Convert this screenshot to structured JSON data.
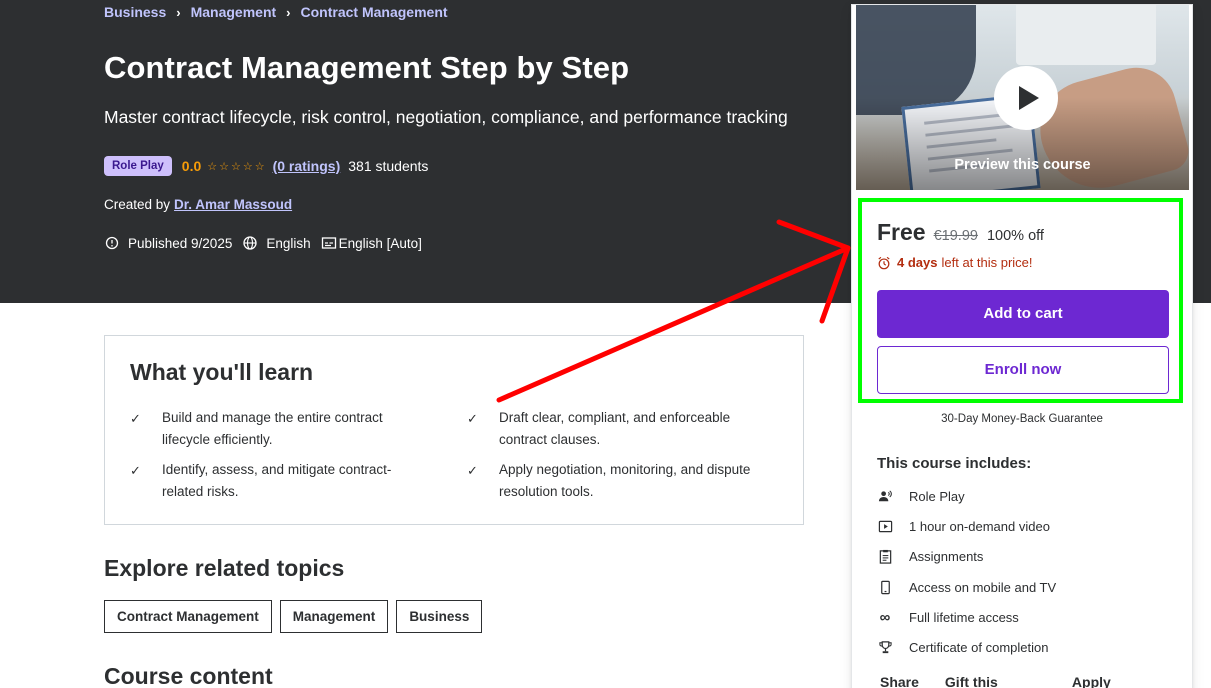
{
  "breadcrumb": [
    "Business",
    "Management",
    "Contract Management"
  ],
  "course": {
    "title": "Contract Management Step by Step",
    "subtitle": "Master contract lifecycle, risk control, negotiation, compliance, and performance tracking",
    "badge": "Role Play",
    "rating": "0.0",
    "ratings_count": "(0 ratings)",
    "students": "381 students",
    "created_by_label": "Created by",
    "author": "Dr. Amar Massoud",
    "published": "Published 9/2025",
    "language": "English",
    "captions": "English [Auto]"
  },
  "learn": {
    "title": "What you'll learn",
    "items": [
      "Build and manage the entire contract lifecycle efficiently.",
      "Draft clear, compliant, and enforceable contract clauses.",
      "Identify, assess, and mitigate contract-related risks.",
      "Apply negotiation, monitoring, and dispute resolution tools."
    ]
  },
  "related": {
    "title": "Explore related topics",
    "topics": [
      "Contract Management",
      "Management",
      "Business"
    ]
  },
  "course_content_title": "Course content",
  "sidebar": {
    "preview_label": "Preview this course",
    "price": "Free",
    "original_price": "€19.99",
    "discount": "100% off",
    "timer_days": "4 days",
    "timer_rest": "left at this price!",
    "add_to_cart": "Add to cart",
    "enroll_now": "Enroll now",
    "guarantee": "30-Day Money-Back Guarantee",
    "includes_title": "This course includes:",
    "includes": [
      {
        "icon": "role-play-icon",
        "label": "Role Play"
      },
      {
        "icon": "video-icon",
        "label": "1 hour on-demand video"
      },
      {
        "icon": "assignment-icon",
        "label": "Assignments"
      },
      {
        "icon": "mobile-icon",
        "label": "Access on mobile and TV"
      },
      {
        "icon": "infinity-icon",
        "label": "Full lifetime access"
      },
      {
        "icon": "trophy-icon",
        "label": "Certificate of completion"
      }
    ],
    "footer_links": [
      "Share",
      "Gift this course",
      "Apply Coupon"
    ]
  },
  "colors": {
    "hero_bg": "#2d2f31",
    "accent_purple": "#6d28d2",
    "link_lavender": "#c0c4fc",
    "star_orange": "#f69c08",
    "timer_red": "#b32d0f",
    "highlight_green": "#00ff00",
    "annotation_arrow": "#ff0000"
  }
}
